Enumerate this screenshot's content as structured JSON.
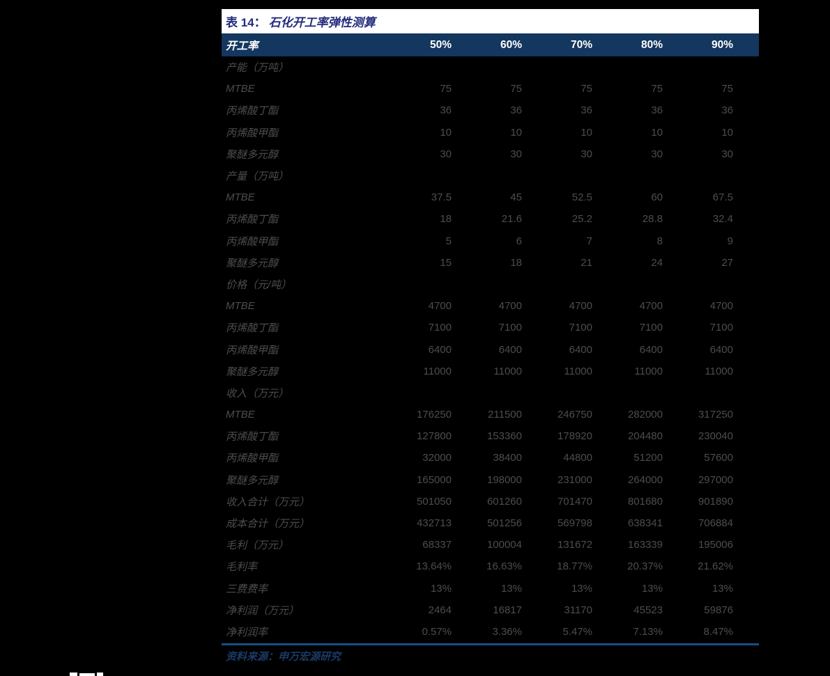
{
  "table": {
    "title_prefix": "表 14：",
    "title_main": "石化开工率弹性测算",
    "header": {
      "label": "开工率",
      "columns": [
        "50%",
        "60%",
        "70%",
        "80%",
        "90%"
      ]
    },
    "rows": [
      {
        "label": "产能（万吨）",
        "section": true,
        "values": [
          "",
          "",
          "",
          "",
          ""
        ]
      },
      {
        "label": "MTBE",
        "section": false,
        "values": [
          "75",
          "75",
          "75",
          "75",
          "75"
        ]
      },
      {
        "label": "丙烯酸丁酯",
        "section": false,
        "values": [
          "36",
          "36",
          "36",
          "36",
          "36"
        ]
      },
      {
        "label": "丙烯酸甲酯",
        "section": false,
        "values": [
          "10",
          "10",
          "10",
          "10",
          "10"
        ]
      },
      {
        "label": "聚醚多元醇",
        "section": false,
        "values": [
          "30",
          "30",
          "30",
          "30",
          "30"
        ]
      },
      {
        "label": "产量（万吨）",
        "section": true,
        "values": [
          "",
          "",
          "",
          "",
          ""
        ]
      },
      {
        "label": "MTBE",
        "section": false,
        "values": [
          "37.5",
          "45",
          "52.5",
          "60",
          "67.5"
        ]
      },
      {
        "label": "丙烯酸丁酯",
        "section": false,
        "values": [
          "18",
          "21.6",
          "25.2",
          "28.8",
          "32.4"
        ]
      },
      {
        "label": "丙烯酸甲酯",
        "section": false,
        "values": [
          "5",
          "6",
          "7",
          "8",
          "9"
        ]
      },
      {
        "label": "聚醚多元醇",
        "section": false,
        "values": [
          "15",
          "18",
          "21",
          "24",
          "27"
        ]
      },
      {
        "label": "价格（元/吨）",
        "section": true,
        "values": [
          "",
          "",
          "",
          "",
          ""
        ]
      },
      {
        "label": "MTBE",
        "section": false,
        "values": [
          "4700",
          "4700",
          "4700",
          "4700",
          "4700"
        ]
      },
      {
        "label": "丙烯酸丁酯",
        "section": false,
        "values": [
          "7100",
          "7100",
          "7100",
          "7100",
          "7100"
        ]
      },
      {
        "label": "丙烯酸甲酯",
        "section": false,
        "values": [
          "6400",
          "6400",
          "6400",
          "6400",
          "6400"
        ]
      },
      {
        "label": "聚醚多元醇",
        "section": false,
        "values": [
          "11000",
          "11000",
          "11000",
          "11000",
          "11000"
        ]
      },
      {
        "label": "收入（万元）",
        "section": true,
        "values": [
          "",
          "",
          "",
          "",
          ""
        ]
      },
      {
        "label": "MTBE",
        "section": false,
        "values": [
          "176250",
          "211500",
          "246750",
          "282000",
          "317250"
        ]
      },
      {
        "label": "丙烯酸丁酯",
        "section": false,
        "values": [
          "127800",
          "153360",
          "178920",
          "204480",
          "230040"
        ]
      },
      {
        "label": "丙烯酸甲酯",
        "section": false,
        "values": [
          "32000",
          "38400",
          "44800",
          "51200",
          "57600"
        ]
      },
      {
        "label": "聚醚多元醇",
        "section": false,
        "values": [
          "165000",
          "198000",
          "231000",
          "264000",
          "297000"
        ]
      },
      {
        "label": "收入合计（万元）",
        "section": false,
        "values": [
          "501050",
          "601260",
          "701470",
          "801680",
          "901890"
        ]
      },
      {
        "label": "成本合计（万元）",
        "section": false,
        "values": [
          "432713",
          "501256",
          "569798",
          "638341",
          "706884"
        ]
      },
      {
        "label": "毛利（万元）",
        "section": false,
        "values": [
          "68337",
          "100004",
          "131672",
          "163339",
          "195006"
        ]
      },
      {
        "label": "毛利率",
        "section": false,
        "values": [
          "13.64%",
          "16.63%",
          "18.77%",
          "20.37%",
          "21.62%"
        ]
      },
      {
        "label": "三费费率",
        "section": false,
        "values": [
          "13%",
          "13%",
          "13%",
          "13%",
          "13%"
        ]
      },
      {
        "label": "净利润（万元）",
        "section": false,
        "values": [
          "2464",
          "16817",
          "31170",
          "45523",
          "59876"
        ]
      },
      {
        "label": "净利润率",
        "section": false,
        "values": [
          "0.57%",
          "3.36%",
          "5.47%",
          "7.13%",
          "8.47%"
        ]
      }
    ],
    "source": "资料来源：申万宏源研究"
  },
  "colors": {
    "page-bg": "#000000",
    "title-bar-bg": "#ffffff",
    "title-text": "#232c7c",
    "header-bg": "#13375e",
    "header-text": "#ffffff",
    "cell-text": "#4d4d4d",
    "divider": "#174e87",
    "source-text": "#1b3a66"
  }
}
